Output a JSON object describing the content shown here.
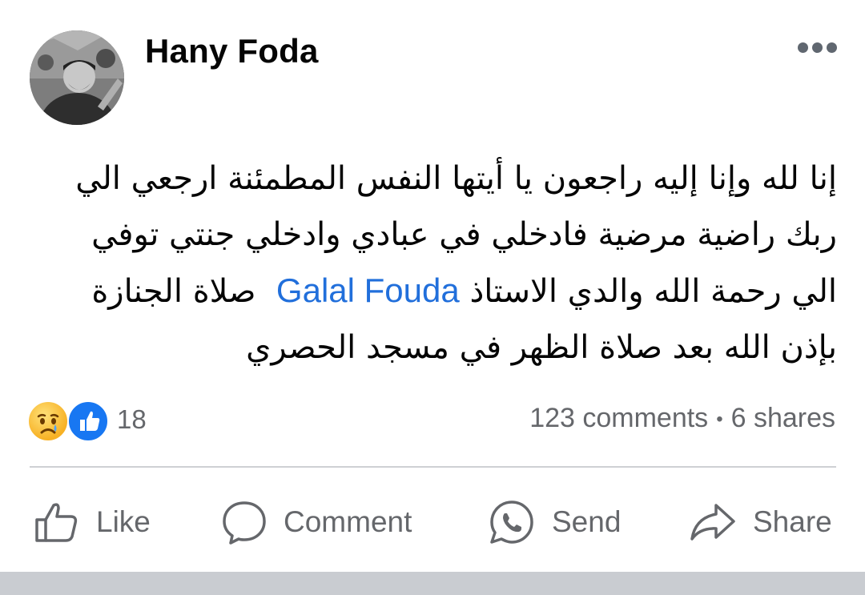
{
  "post": {
    "author": "Hany Foda",
    "text_lines": [
      "إنا لله وإنا إليه راجعون يا أيتها النفس المطمئنة ارجعي الي",
      "ربك راضية مرضية فادخلي في عبادي وادخلي جنتي توفي",
      "صلاة الجنازة",
      "بإذن الله بعد صلاة الظهر في مسجد الحصري"
    ],
    "line3_before": "الي رحمة الله والدي الاستاذ",
    "mention": "Galal Fouda",
    "line3_after": "صلاة الجنازة"
  },
  "reactions": {
    "icons": [
      "sad-face-icon",
      "thumbs-up-icon"
    ],
    "count": "18"
  },
  "stats": {
    "comments": "123 comments",
    "separator": "•",
    "shares": "6 shares"
  },
  "actions": {
    "like": "Like",
    "comment": "Comment",
    "send": "Send",
    "share": "Share"
  },
  "colors": {
    "text": "#050505",
    "secondary": "#65676b",
    "link": "#216fdb",
    "like_blue": "#1877f2",
    "divider": "#ced0d4"
  }
}
